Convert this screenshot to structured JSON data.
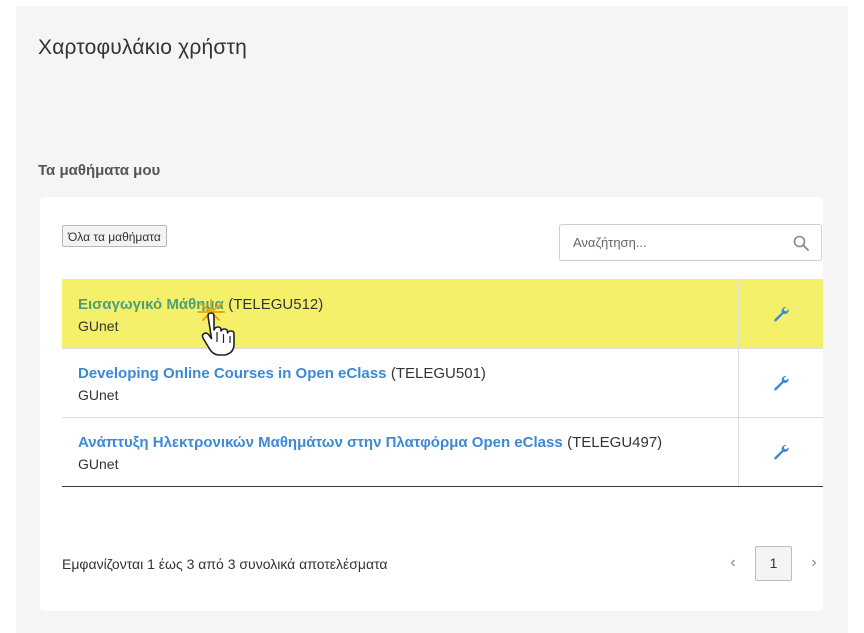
{
  "page": {
    "title": "Χαρτοφυλάκιο χρήστη"
  },
  "courses_section": {
    "heading": "Τα μαθήματα μου",
    "all_courses_label": "Όλα τα μαθήματα",
    "search": {
      "placeholder": "Αναζήτηση...",
      "value": "",
      "icon": "search-icon"
    },
    "rows": [
      {
        "title": "Εισαγωγικό Μάθημα",
        "code": "(TELEGU512)",
        "institution": "GUnet",
        "highlighted": true,
        "tool_icon": "wrench-icon"
      },
      {
        "title": "Developing Online Courses in Open eClass",
        "code": "(TELEGU501)",
        "institution": "GUnet",
        "highlighted": false,
        "tool_icon": "wrench-icon"
      },
      {
        "title": "Ανάπτυξη Ηλεκτρονικών Μαθημάτων στην Πλατφόρμα Open eClass",
        "code": "(TELEGU497)",
        "institution": "GUnet",
        "highlighted": false,
        "tool_icon": "wrench-icon"
      }
    ],
    "footer_info": "Εμφανίζονται 1 έως 3 από 3 συνολικά αποτελέσματα",
    "pagination": {
      "prev": "‹",
      "current_page": "1",
      "next": "›"
    }
  },
  "colors": {
    "highlight": "#f5f06a",
    "link": "#3d89d6",
    "link_active": "#4ba07a",
    "accent_icon": "#3d89d6"
  }
}
